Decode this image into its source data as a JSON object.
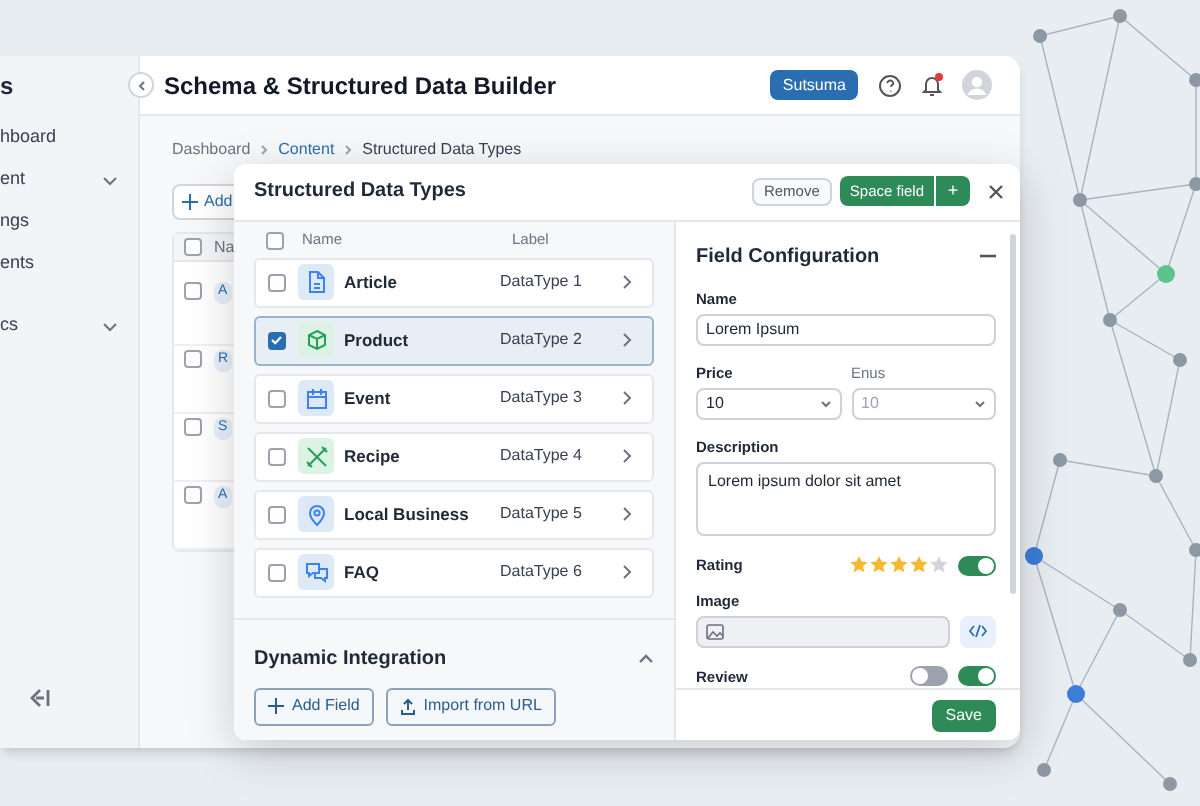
{
  "back_window": {
    "sidebar": {
      "title": "s",
      "items": [
        {
          "label": "hboard",
          "expandable": false
        },
        {
          "label": "ent",
          "expandable": true
        },
        {
          "label": "ngs",
          "expandable": false
        },
        {
          "label": "ents",
          "expandable": false
        },
        {
          "label": "cs",
          "expandable": true
        }
      ]
    },
    "title": "Schema & Structured Data Builder",
    "workspace_button": "Sutsuma",
    "breadcrumb": [
      "Dashboard",
      "Content",
      "Structured Data Types"
    ],
    "add_button": "Add",
    "table": {
      "header": "Na",
      "all_checked": false,
      "rows": [
        {
          "badge": "A",
          "checked": false
        },
        {
          "badge": "R",
          "checked": false
        },
        {
          "badge": "S",
          "checked": false
        },
        {
          "badge": "A",
          "checked": false
        }
      ]
    }
  },
  "dialog": {
    "title": "Structured Data Types",
    "buttons": {
      "remove": "Remove",
      "primary": "Space field",
      "add": "+"
    },
    "columns": [
      "Name",
      "Label"
    ],
    "all_checked": false,
    "rows": [
      {
        "name": "Article",
        "label": "DataType 1",
        "kind": "document",
        "color": "#3b82f6",
        "selected": false
      },
      {
        "name": "Product",
        "label": "DataType 2",
        "kind": "box",
        "color": "#22a05a",
        "selected": true
      },
      {
        "name": "Event",
        "label": "DataType 3",
        "kind": "calendar",
        "color": "#3b82f6",
        "selected": false
      },
      {
        "name": "Recipe",
        "label": "DataType 4",
        "kind": "utensils",
        "color": "#22a05a",
        "selected": false
      },
      {
        "name": "Local Business",
        "label": "DataType 5",
        "kind": "pin",
        "color": "#3b82f6",
        "selected": false
      },
      {
        "name": "FAQ",
        "label": "DataType 6",
        "kind": "chat",
        "color": "#3b82f6",
        "selected": false
      }
    ],
    "integration": {
      "title": "Dynamic Integration",
      "expanded": true,
      "buttons": [
        {
          "label": "Add Field",
          "kind": "add"
        },
        {
          "label": "Import from URL",
          "kind": "import"
        }
      ]
    },
    "config": {
      "title": "Field Configuration",
      "name": {
        "label": "Name",
        "value": "Lorem Ipsum"
      },
      "price": {
        "label": "Price",
        "value": "10",
        "disabled": false
      },
      "enus": {
        "label": "Enus",
        "value": "10",
        "disabled": true
      },
      "description": {
        "label": "Description",
        "value": "Lorem ipsum dolor sit amet"
      },
      "rating": {
        "label": "Rating",
        "stars": 4,
        "on": true
      },
      "image": {
        "label": "Image"
      },
      "review": {
        "label": "Review",
        "toggles": [
          {
            "on": false
          },
          {
            "on": true
          }
        ]
      },
      "save": "Save"
    }
  }
}
